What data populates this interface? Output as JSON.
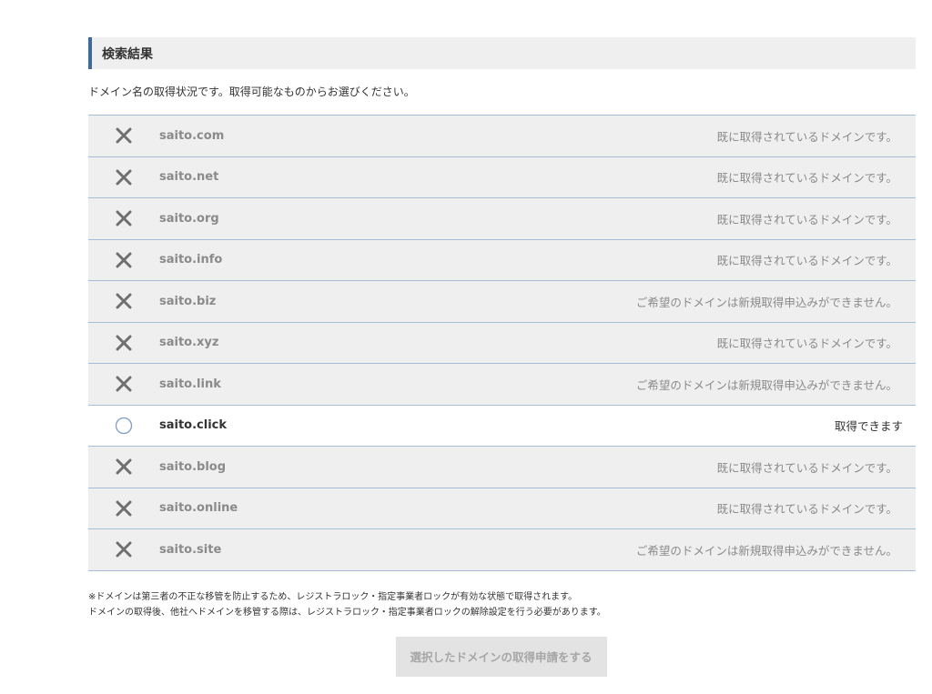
{
  "header": {
    "title": "検索結果"
  },
  "intro": "ドメイン名の取得状況です。取得可能なものからお選びください。",
  "results": [
    {
      "domain": "saito.com",
      "status": "unavailable",
      "icon": "cross-icon",
      "message": "既に取得されているドメインです。"
    },
    {
      "domain": "saito.net",
      "status": "unavailable",
      "icon": "cross-icon",
      "message": "既に取得されているドメインです。"
    },
    {
      "domain": "saito.org",
      "status": "unavailable",
      "icon": "cross-icon",
      "message": "既に取得されているドメインです。"
    },
    {
      "domain": "saito.info",
      "status": "unavailable",
      "icon": "cross-icon",
      "message": "既に取得されているドメインです。"
    },
    {
      "domain": "saito.biz",
      "status": "unavailable",
      "icon": "cross-icon",
      "message": "ご希望のドメインは新規取得申込みができません。"
    },
    {
      "domain": "saito.xyz",
      "status": "unavailable",
      "icon": "cross-icon",
      "message": "既に取得されているドメインです。"
    },
    {
      "domain": "saito.link",
      "status": "unavailable",
      "icon": "cross-icon",
      "message": "ご希望のドメインは新規取得申込みができません。"
    },
    {
      "domain": "saito.click",
      "status": "available",
      "icon": "radio-icon",
      "message": "取得できます"
    },
    {
      "domain": "saito.blog",
      "status": "unavailable",
      "icon": "cross-icon",
      "message": "既に取得されているドメインです。"
    },
    {
      "domain": "saito.online",
      "status": "unavailable",
      "icon": "cross-icon",
      "message": "既に取得されているドメインです。"
    },
    {
      "domain": "saito.site",
      "status": "unavailable",
      "icon": "cross-icon",
      "message": "ご希望のドメインは新規取得申込みができません。"
    }
  ],
  "notes": [
    "※ドメインは第三者の不正な移管を防止するため、レジストラロック・指定事業者ロックが有効な状態で取得されます。",
    "ドメインの取得後、他社へドメインを移管する際は、レジストラロック・指定事業者ロックの解除設定を行う必要があります。"
  ],
  "submit_label": "選択したドメインの取得申請をする",
  "colors": {
    "accent": "#3a6ba5",
    "row_border": "#a9bcd6",
    "unavailable_bg": "#efefef",
    "available_bg": "#ffffff",
    "button_bg": "#e3e3e3"
  }
}
